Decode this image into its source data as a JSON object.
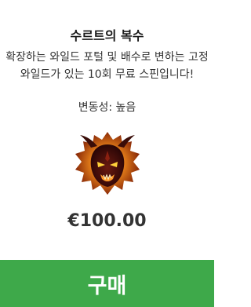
{
  "offer": {
    "title": "수르트의 복수",
    "description": "확장하는 와일드 포털 및 배수로 변하는 고정 와일드가 있는 10회 무료 스핀입니다!",
    "volatility": "변동성: 높음",
    "artwork_icon": "demon-head-icon",
    "price": "€100.00",
    "buy_label": "구매"
  },
  "colors": {
    "buy_button": "#3ea94a",
    "text": "#333333"
  }
}
